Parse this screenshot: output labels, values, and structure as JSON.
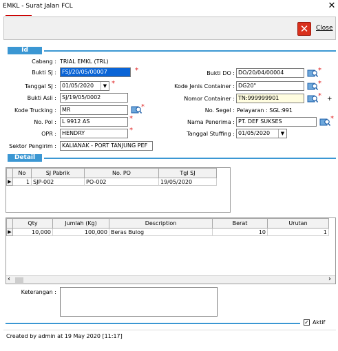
{
  "window": {
    "title": "EMKL - Surat Jalan FCL",
    "close_glyph": "✕"
  },
  "toolbar": {
    "close_label": "Close",
    "close_icon": "close-x-icon"
  },
  "sections": {
    "id_label": "Id",
    "detail_label": "Detail"
  },
  "form": {
    "cabang_label": "Cabang :",
    "cabang_value": "TRIAL EMKL (TRL)",
    "bukti_sj_label": "Bukti SJ :",
    "bukti_sj_value": "FSJ/20/05/00007",
    "tanggal_sj_label": "Tanggal SJ :",
    "tanggal_sj_value": "01/05/2020",
    "bukti_asli_label": "Bukti Asli :",
    "bukti_asli_value": "SJ/19/05/0002",
    "kode_trucking_label": "Kode Trucking :",
    "kode_trucking_value": "MR",
    "no_pol_label": "No. Pol :",
    "no_pol_value": "L 9912 AS",
    "opr_label": "OPR :",
    "opr_value": "HENDRY",
    "sektor_label": "Sektor Pengirim :",
    "sektor_value": "KALIANAK - PORT TANJUNG PEF",
    "bukti_do_label": "Bukti DO :",
    "bukti_do_value": "DO/20/04/00004",
    "kode_jenis_label": "Kode Jenis Container :",
    "kode_jenis_value": "DG20\"",
    "nomor_container_label": "Nomor Container :",
    "nomor_container_value": "TN:999999901",
    "no_segel_label": "No. Segel :",
    "no_segel_value": "Pelayaran : SGL:991",
    "nama_penerima_label": "Nama Penerima :",
    "nama_penerima_value": "PT. DEF SUKSES",
    "tanggal_stuffing_label": "Tanggal Stuffing :",
    "tanggal_stuffing_value": "01/05/2020",
    "required_mark": "*",
    "plus_mark": "+"
  },
  "grid1": {
    "headers": [
      "No",
      "SJ Pabrik",
      "No. PO",
      "Tgl SJ"
    ],
    "rows": [
      {
        "no": "1",
        "sj_pabrik": "SJP-002",
        "no_po": "PO-002",
        "tgl_sj": "19/05/2020"
      }
    ]
  },
  "grid2": {
    "headers": [
      "Qty",
      "Jumlah (Kg)",
      "Description",
      "Berat",
      "Urutan"
    ],
    "rows": [
      {
        "qty": "10,000",
        "jumlah": "100,000",
        "description": "Beras Bulog",
        "berat": "10",
        "urutan": "1"
      }
    ]
  },
  "scroll": {
    "left_arrow": "‹",
    "right_arrow": "›"
  },
  "keterangan_label": "Keterangan :",
  "aktif": {
    "label": "Aktif",
    "checked": true,
    "check_glyph": "✓"
  },
  "status_text": "Created by admin at 19 May 2020 [11:17]",
  "colors": {
    "section": "#3b97d3",
    "highlight": "#0a64d6",
    "required": "#e02020",
    "close_icon": "#d9301c"
  }
}
